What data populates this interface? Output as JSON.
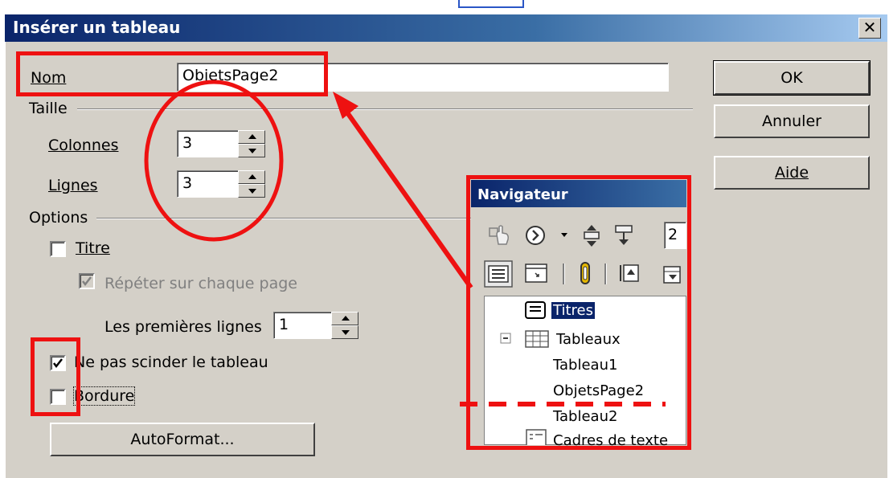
{
  "dialog": {
    "title": "Insérer un tableau",
    "close_icon": "close-icon"
  },
  "name": {
    "label": "Nom",
    "value": "ObjetsPage2"
  },
  "size": {
    "group_label": "Taille",
    "columns_label": "Colonnes",
    "columns_value": "3",
    "rows_label": "Lignes",
    "rows_value": "3"
  },
  "options": {
    "group_label": "Options",
    "title_label": "Titre",
    "title_checked": false,
    "repeat_label": "Répéter sur chaque page",
    "repeat_checked": true,
    "first_rows_label": "Les premières lignes",
    "first_rows_value": "1",
    "no_split_label": "Ne pas scinder le tableau",
    "no_split_checked": true,
    "border_label": "Bordure",
    "border_checked": false
  },
  "buttons": {
    "autoformat": "AutoFormat...",
    "ok": "OK",
    "cancel": "Annuler",
    "help": "Aide"
  },
  "navigator": {
    "title": "Navigateur",
    "page_value": "2",
    "tree": {
      "titles": "Titres",
      "tables": "Tableaux",
      "table1": "Tableau1",
      "objetspage2": "ObjetsPage2",
      "table2": "Tableau2",
      "text_frames": "Cadres de texte"
    }
  },
  "colors": {
    "annotation": "#ee1111",
    "dialog_bg": "#d4d0c8",
    "titlebar": "#0a246a"
  }
}
